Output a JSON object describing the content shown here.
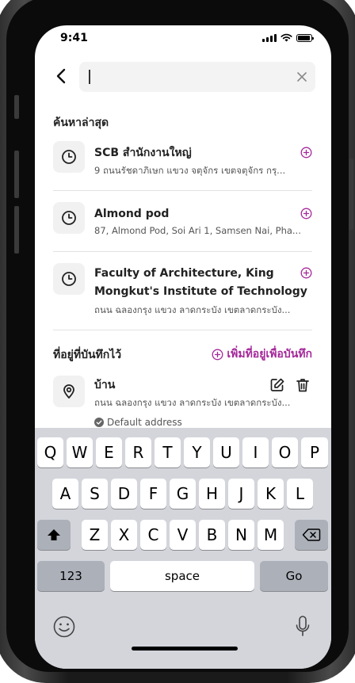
{
  "status": {
    "time": "9:41"
  },
  "search": {
    "placeholder": ""
  },
  "recent": {
    "title": "ค้นหาล่าสุด",
    "items": [
      {
        "title": "SCB สำนักงานใหญ่",
        "subtitle": "9 ถนนรัชดาภิเษก แขวง จตุจักร เขตจตุจักร กรุ..."
      },
      {
        "title": "Almond pod",
        "subtitle": "87, Almond Pod, Soi Ari 1, Samsen Nai, Pha..."
      },
      {
        "title": "Faculty of Architecture, King",
        "title2": "Mongkut's Institute of Technology",
        "subtitle": "ถนน ฉลองกรุง แขวง ลาดกระบัง เขตลาดกระบัง..."
      }
    ]
  },
  "saved": {
    "title": "ที่อยู่ที่บันทึกไว้",
    "add_label": "เพิ่มที่อยู่เพื่อบันทึก",
    "items": [
      {
        "title": "บ้าน",
        "subtitle": "ถนน ฉลองกรุง แขวง ลาดกระบัง เขตลาดกระบัง...",
        "badge": "Default address"
      }
    ]
  },
  "keyboard": {
    "row1": [
      "Q",
      "W",
      "E",
      "R",
      "T",
      "Y",
      "U",
      "I",
      "O",
      "P"
    ],
    "row2": [
      "A",
      "S",
      "D",
      "F",
      "G",
      "H",
      "J",
      "K",
      "L"
    ],
    "row3": [
      "Z",
      "X",
      "C",
      "V",
      "B",
      "N",
      "M"
    ],
    "numbers_label": "123",
    "space_label": "space",
    "go_label": "Go"
  },
  "colors": {
    "accent": "#a5289a",
    "keyboard_bg": "#d3d5db"
  }
}
